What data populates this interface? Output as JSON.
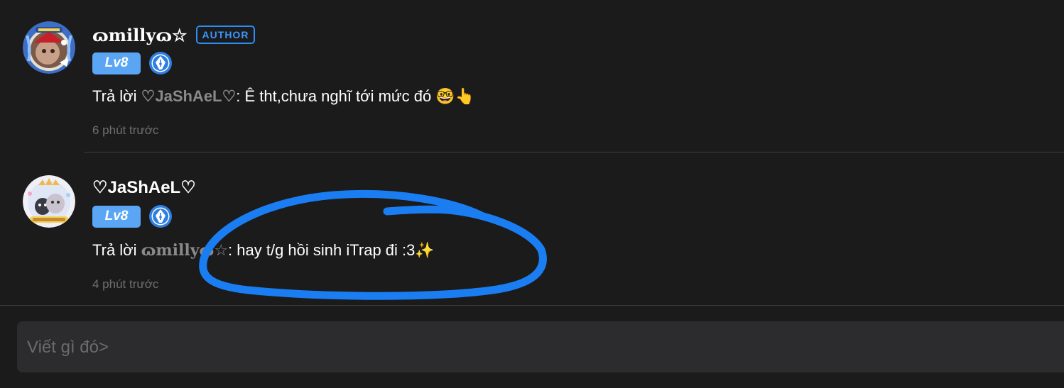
{
  "comments": [
    {
      "username": "ɷmillyɷ☆",
      "author_badge": "AUTHOR",
      "level": "Lv8",
      "reply_prefix": "Trả lời ",
      "reply_target": "♡JaShAeL♡",
      "reply_text": ": Ê tht,chưa nghĩ tới mức đó ",
      "emoji": "🤓👆",
      "timestamp": "6 phút trước",
      "avatar_icon": "avatar-writer-icon",
      "badge_icon": "pen-nib-icon"
    },
    {
      "username": "♡JaShAeL♡",
      "level": "Lv8",
      "reply_prefix": "Trả lời ",
      "reply_target": "ɷmillyɷ",
      "reply_target_star": "☆",
      "reply_text": ": hay t/g hồi sinh iTrap đi :3",
      "emoji": "✨",
      "timestamp": "4 phút trước",
      "avatar_icon": "avatar-cats-icon",
      "badge_icon": "pen-nib-icon"
    }
  ],
  "composer": {
    "placeholder": "Viết gì đó>"
  },
  "colors": {
    "background": "#1b1b1c",
    "accent": "#2d8cf5",
    "level_badge": "#5aa6f4",
    "scribble": "#1a7ef2",
    "muted": "#6f6f6f"
  }
}
